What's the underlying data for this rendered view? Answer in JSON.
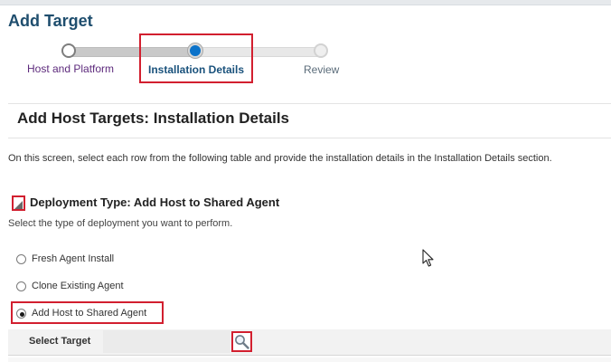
{
  "page": {
    "title": "Add Target"
  },
  "train": {
    "steps": [
      {
        "label": "Host and Platform",
        "state": "visited"
      },
      {
        "label": "Installation Details",
        "state": "current"
      },
      {
        "label": "Review",
        "state": "unvisited"
      }
    ]
  },
  "section": {
    "title": "Add Host Targets: Installation Details",
    "instructions": "On this screen, select each row from the following table and provide the installation details in the Installation Details section."
  },
  "deployment": {
    "title": "Deployment Type: Add Host to Shared Agent",
    "description": "Select the type of deployment you want to perform.",
    "options": [
      {
        "label": "Fresh Agent Install",
        "selected": false
      },
      {
        "label": "Clone Existing Agent",
        "selected": false
      },
      {
        "label": "Add Host to Shared Agent",
        "selected": true
      }
    ]
  },
  "target": {
    "label": "Select Target",
    "value": ""
  },
  "colors": {
    "title": "#1f4e6e",
    "highlight": "#d21f2f",
    "current_step": "#0b72c9"
  },
  "icons": {
    "disclosure": "disclosure-triangle-icon",
    "search": "magnifier-search-icon",
    "cursor": "mouse-pointer-icon"
  }
}
